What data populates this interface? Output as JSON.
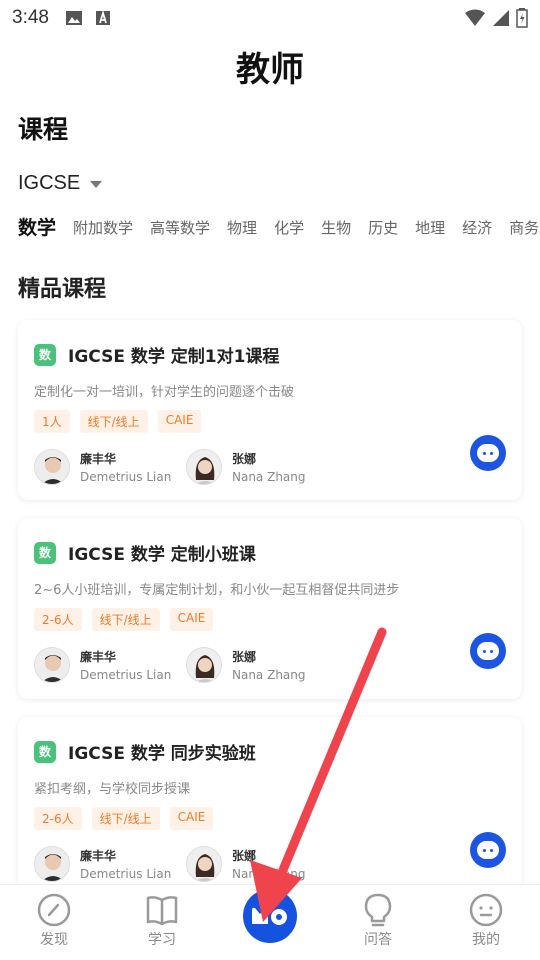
{
  "status_bar": {
    "time": "3:48"
  },
  "page_title": "教师",
  "section_title": "课程",
  "curriculum": {
    "selected": "IGCSE"
  },
  "subject_tabs": [
    "数学",
    "附加数学",
    "高等数学",
    "物理",
    "化学",
    "生物",
    "历史",
    "地理",
    "经济",
    "商务"
  ],
  "active_tab": 0,
  "featured_title": "精品课程",
  "courses": [
    {
      "icon_label": "数",
      "title": "IGCSE 数学 定制1对1课程",
      "description": "定制化一对一培训，针对学生的问题逐个击破",
      "tags": [
        "1人",
        "线下/线上",
        "CAIE"
      ],
      "teachers": [
        {
          "name": "廉丰华",
          "en": "Demetrius Lian"
        },
        {
          "name": "张娜",
          "en": "Nana Zhang"
        }
      ]
    },
    {
      "icon_label": "数",
      "title": "IGCSE 数学 定制小班课",
      "description": "2~6人小班培训，专属定制计划，和小伙一起互相督促共同进步",
      "tags": [
        "2-6人",
        "线下/线上",
        "CAIE"
      ],
      "teachers": [
        {
          "name": "廉丰华",
          "en": "Demetrius Lian"
        },
        {
          "name": "张娜",
          "en": "Nana Zhang"
        }
      ]
    },
    {
      "icon_label": "数",
      "title": "IGCSE 数学 同步实验班",
      "description": "紧扣考纲，与学校同步授课",
      "tags": [
        "2-6人",
        "线下/线上",
        "CAIE"
      ],
      "teachers": [
        {
          "name": "廉丰华",
          "en": "Demetrius Lian"
        },
        {
          "name": "张娜",
          "en": "Nana Zhang"
        }
      ]
    }
  ],
  "bottom_nav": {
    "items": [
      {
        "label": "发现",
        "icon": "compass-icon"
      },
      {
        "label": "学习",
        "icon": "book-icon"
      },
      {
        "label": "",
        "icon": "logo-icon"
      },
      {
        "label": "问答",
        "icon": "lightbulb-icon"
      },
      {
        "label": "我的",
        "icon": "face-icon"
      }
    ]
  },
  "colors": {
    "accent": "#1652e0",
    "tag_text": "#f07a2a",
    "tag_bg": "#fff1e6",
    "badge": "#49c27a",
    "annotation_arrow": "#f0444c"
  }
}
